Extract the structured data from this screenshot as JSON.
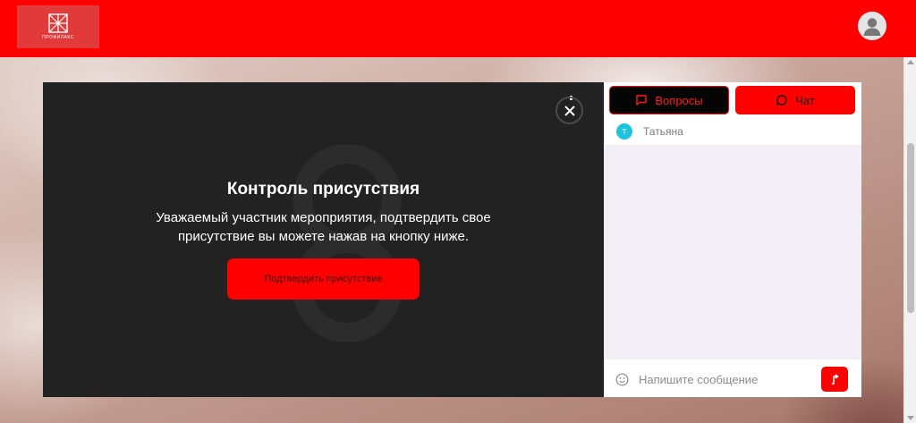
{
  "header": {
    "logo_text": "ПРОФИЛАКС",
    "avatar_icon": "user-avatar-icon"
  },
  "modal": {
    "title": "Контроль присутствия",
    "text": "Уважаемый участник мероприятия, подтвердить свое присутствие вы можете нажав на кнопку ниже.",
    "confirm_label": "Подтвердить присутствие",
    "close_icon": "close-icon"
  },
  "chat": {
    "tabs": [
      {
        "label": "Вопросы",
        "icon": "message-square-icon"
      },
      {
        "label": "Чат",
        "icon": "chat-bubble-icon"
      }
    ],
    "messages": [
      {
        "author": "Татьяна",
        "initial": "Т"
      }
    ],
    "input_placeholder": "Напишите сообщение",
    "send_icon": "send-icon",
    "emoji_icon": "smile-icon"
  },
  "colors": {
    "brand_red": "#ff0000",
    "panel_dark": "#222222",
    "chat_bg": "#f1eff5",
    "avatar_cyan": "#1fc4dc"
  }
}
